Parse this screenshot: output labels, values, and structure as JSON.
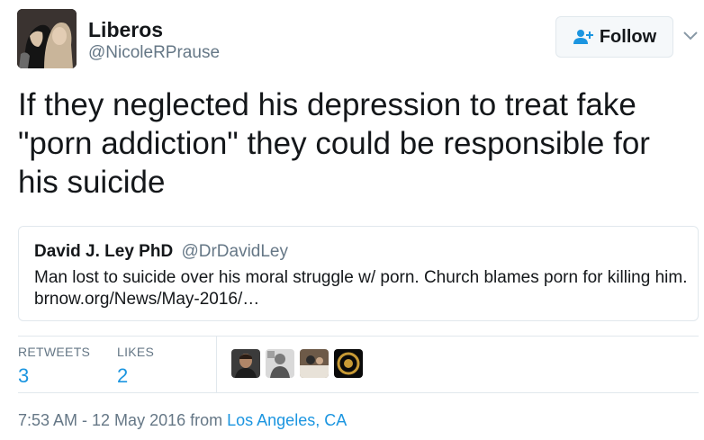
{
  "author": {
    "display_name": "Liberos",
    "handle": "@NicoleRPrause",
    "avatar_icon": "profile-photo"
  },
  "follow_button": {
    "label": "Follow",
    "icon": "add-user-icon",
    "accent_color": "#1b95e0"
  },
  "tweet": {
    "text": "If they neglected his depression to treat fake \"porn addiction\" they could be responsible for his suicide"
  },
  "quoted_tweet": {
    "author_name": "David J. Ley PhD",
    "author_handle": "@DrDavidLey",
    "text": "Man lost to suicide over his moral struggle w/ porn. Church blames porn for killing him. brnow.org/News/May-2016/…"
  },
  "stats": {
    "retweets_label": "RETWEETS",
    "retweets_count": "3",
    "likes_label": "LIKES",
    "likes_count": "2"
  },
  "likers": [
    "liker-avatar-1",
    "liker-avatar-2",
    "liker-avatar-3",
    "liker-avatar-4"
  ],
  "footer": {
    "timestamp": "7:53 AM - 12 May 2016 from",
    "location": "Los Angeles, CA"
  }
}
